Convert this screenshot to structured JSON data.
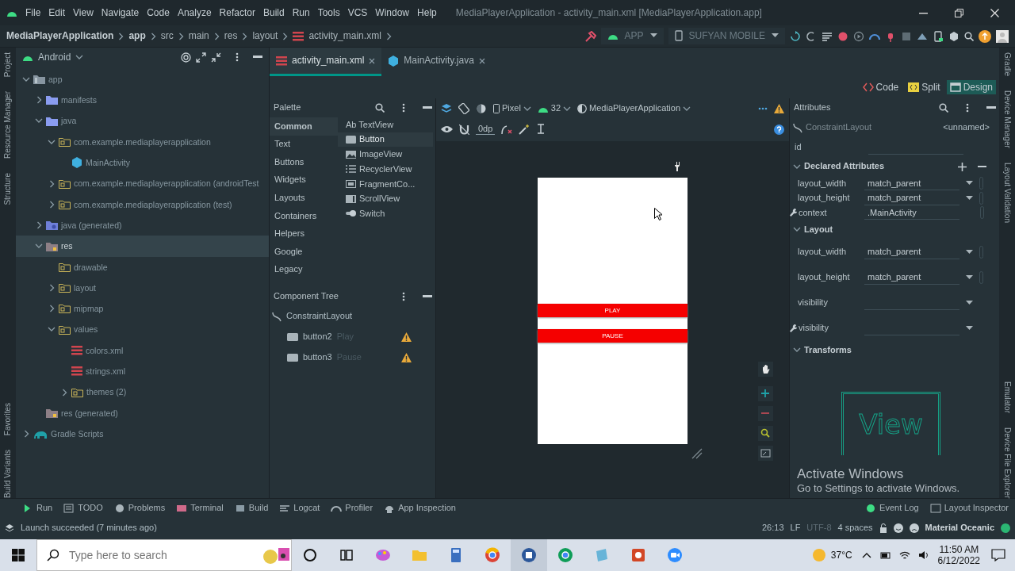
{
  "menu_bar": {
    "items": [
      "File",
      "Edit",
      "View",
      "Navigate",
      "Code",
      "Analyze",
      "Refactor",
      "Build",
      "Run",
      "Tools",
      "VCS",
      "Window",
      "Help"
    ],
    "title": "MediaPlayerApplication - activity_main.xml [MediaPlayerApplication.app]"
  },
  "breadcrumb": [
    "MediaPlayerApplication",
    "app",
    "src",
    "main",
    "res",
    "layout",
    "activity_main.xml"
  ],
  "run_config": {
    "module": "APP",
    "device": "SUFYAN MOBILE"
  },
  "left_stripe": [
    "Project",
    "Resource Manager",
    "Structure",
    "Favorites",
    "Build Variants"
  ],
  "right_stripe": [
    "Gradle",
    "Device Manager",
    "Layout Validation",
    "Emulator",
    "Device File Explorer"
  ],
  "project": {
    "view": "Android",
    "tree": [
      {
        "label": "app",
        "kind": "module",
        "expanded": true,
        "selected": false,
        "children": [
          {
            "label": "manifests",
            "kind": "folder",
            "expanded": false,
            "selected": false
          },
          {
            "label": "java",
            "kind": "folder",
            "expanded": true,
            "selected": false,
            "children": [
              {
                "label": "com.example.mediaplayerapplication",
                "kind": "package",
                "expanded": true,
                "selected": false,
                "children": [
                  {
                    "label": "MainActivity",
                    "kind": "class",
                    "selected": false
                  }
                ]
              },
              {
                "label": "com.example.mediaplayerapplication (androidTest",
                "kind": "package",
                "expanded": false,
                "selected": false
              },
              {
                "label": "com.example.mediaplayerapplication (test)",
                "kind": "package",
                "expanded": false,
                "selected": false
              }
            ]
          },
          {
            "label": "java (generated)",
            "kind": "generated",
            "expanded": false,
            "selected": false
          },
          {
            "label": "res",
            "kind": "res",
            "expanded": true,
            "selected": true,
            "children": [
              {
                "label": "drawable",
                "kind": "package",
                "selected": false
              },
              {
                "label": "layout",
                "kind": "package",
                "expanded": false,
                "selected": false
              },
              {
                "label": "mipmap",
                "kind": "package",
                "expanded": false,
                "selected": false
              },
              {
                "label": "values",
                "kind": "package",
                "expanded": true,
                "selected": false,
                "children": [
                  {
                    "label": "colors.xml",
                    "kind": "xml",
                    "selected": false
                  },
                  {
                    "label": "strings.xml",
                    "kind": "xml",
                    "selected": false
                  },
                  {
                    "label": "themes (2)",
                    "kind": "package",
                    "expanded": false,
                    "selected": false
                  }
                ]
              }
            ]
          },
          {
            "label": "res (generated)",
            "kind": "res",
            "selected": false
          }
        ]
      },
      {
        "label": "Gradle Scripts",
        "kind": "gradle",
        "expanded": false,
        "selected": false
      }
    ]
  },
  "editor_tabs": [
    {
      "label": "activity_main.xml",
      "kind": "xml",
      "selected": true
    },
    {
      "label": "MainActivity.java",
      "kind": "class",
      "selected": false
    }
  ],
  "view_modes": [
    {
      "label": "Code",
      "selected": false
    },
    {
      "label": "Split",
      "selected": false
    },
    {
      "label": "Design",
      "selected": true
    }
  ],
  "palette": {
    "title": "Palette",
    "categories": [
      {
        "label": "Common",
        "selected": true
      },
      {
        "label": "Text",
        "selected": false
      },
      {
        "label": "Buttons",
        "selected": false
      },
      {
        "label": "Widgets",
        "selected": false
      },
      {
        "label": "Layouts",
        "selected": false
      },
      {
        "label": "Containers",
        "selected": false
      },
      {
        "label": "Helpers",
        "selected": false
      },
      {
        "label": "Google",
        "selected": false
      },
      {
        "label": "Legacy",
        "selected": false
      }
    ],
    "widgets": [
      {
        "label": "TextView",
        "kind": "text",
        "glyph": "Ab",
        "selected": false
      },
      {
        "label": "Button",
        "kind": "button",
        "selected": true
      },
      {
        "label": "ImageView",
        "kind": "image",
        "selected": false
      },
      {
        "label": "RecyclerView",
        "kind": "list",
        "selected": false
      },
      {
        "label": "FragmentCo...",
        "kind": "fragment",
        "selected": false
      },
      {
        "label": "ScrollView",
        "kind": "scroll",
        "selected": false
      },
      {
        "label": "Switch",
        "kind": "switch",
        "selected": false
      }
    ]
  },
  "component_tree": {
    "title": "Component Tree",
    "root": "ConstraintLayout",
    "children": [
      {
        "id": "button2",
        "text": "Play",
        "warning": true
      },
      {
        "id": "button3",
        "text": "Pause",
        "warning": true
      }
    ]
  },
  "design_toolbar": {
    "device": "Pixel",
    "api": "32",
    "theme": "MediaPlayerApplication",
    "margin": "0dp"
  },
  "preview": {
    "buttons": [
      "PLAY",
      "PAUSE"
    ]
  },
  "attributes": {
    "title": "Attributes",
    "class": "ConstraintLayout",
    "name": "<unnamed>",
    "id_label": "id",
    "sections": [
      {
        "title": "Declared Attributes",
        "expanded": true,
        "actions": true,
        "rows": [
          {
            "label": "layout_width",
            "value": "match_parent",
            "kind": "dropdown"
          },
          {
            "label": "layout_height",
            "value": "match_parent",
            "kind": "dropdown"
          },
          {
            "label": "context",
            "value": ".MainActivity",
            "kind": "text",
            "tool": true
          }
        ]
      },
      {
        "title": "Layout",
        "expanded": true,
        "rows": [
          {
            "label": "layout_width",
            "value": "match_parent",
            "kind": "dropdown"
          },
          {
            "label": "layout_height",
            "value": "match_parent",
            "kind": "dropdown"
          },
          {
            "label": "visibility",
            "kind": "dropdown"
          },
          {
            "label": "visibility",
            "kind": "dropdown",
            "tool": true
          }
        ]
      },
      {
        "title": "Transforms",
        "expanded": true,
        "preview_text": "View"
      }
    ]
  },
  "tool_windows": [
    {
      "label": "Run",
      "kind": "run"
    },
    {
      "label": "TODO",
      "kind": "todo"
    },
    {
      "label": "Problems",
      "kind": "problems"
    },
    {
      "label": "Terminal",
      "kind": "terminal"
    },
    {
      "label": "Build",
      "kind": "build"
    },
    {
      "label": "Logcat",
      "kind": "logcat"
    },
    {
      "label": "Profiler",
      "kind": "profiler"
    },
    {
      "label": "App Inspection",
      "kind": "inspection"
    }
  ],
  "tool_windows_right": [
    {
      "label": "Event Log",
      "kind": "log"
    },
    {
      "label": "Layout Inspector",
      "kind": "inspector"
    }
  ],
  "status_bar": {
    "message": "Launch succeeded (7 minutes ago)",
    "position": "26:13",
    "line_separator": "LF",
    "encoding": "UTF-8",
    "indent": "4 spaces",
    "theme": "Material Oceanic"
  },
  "activation_notice": {
    "title": "Activate Windows",
    "text": "Go to Settings to activate Windows."
  },
  "taskbar": {
    "search_placeholder": "Type here to search",
    "weather": "37°C",
    "time": "11:50 AM",
    "date": "6/12/2022"
  }
}
